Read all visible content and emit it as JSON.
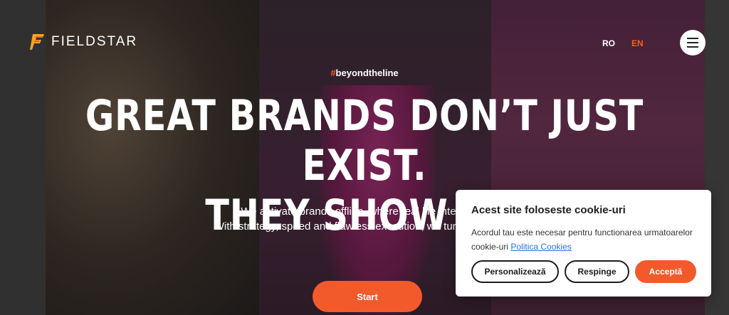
{
  "brand": {
    "name": "FIELDSTAR",
    "icon": "fieldstar-logo-icon",
    "accent": "#f25a2b"
  },
  "nav": {
    "lang_ro": "RO",
    "lang_en": "EN",
    "menu_icon": "hamburger-menu-icon"
  },
  "hero": {
    "hashtag_symbol": "#",
    "hashtag_text": "beyondtheline",
    "headline_line1": "GREAT BRANDS DON’T JUST EXIST.",
    "headline_line2": "THEY SHOW UP.",
    "sub_line1": "We activate brands offline, where real life interaction",
    "sub_line2": "With strategy, speed and flawless execution, we turn theory into",
    "start_label": "Start"
  },
  "cookie": {
    "title": "Acest site foloseste cookie-uri",
    "text": "Acordul tau este necesar pentru functionarea urmatoarelor cookie-uri",
    "link": "Politica Cookies",
    "btn_personalize": "Personalizează",
    "btn_reject": "Respinge",
    "btn_accept": "Acceptă"
  }
}
